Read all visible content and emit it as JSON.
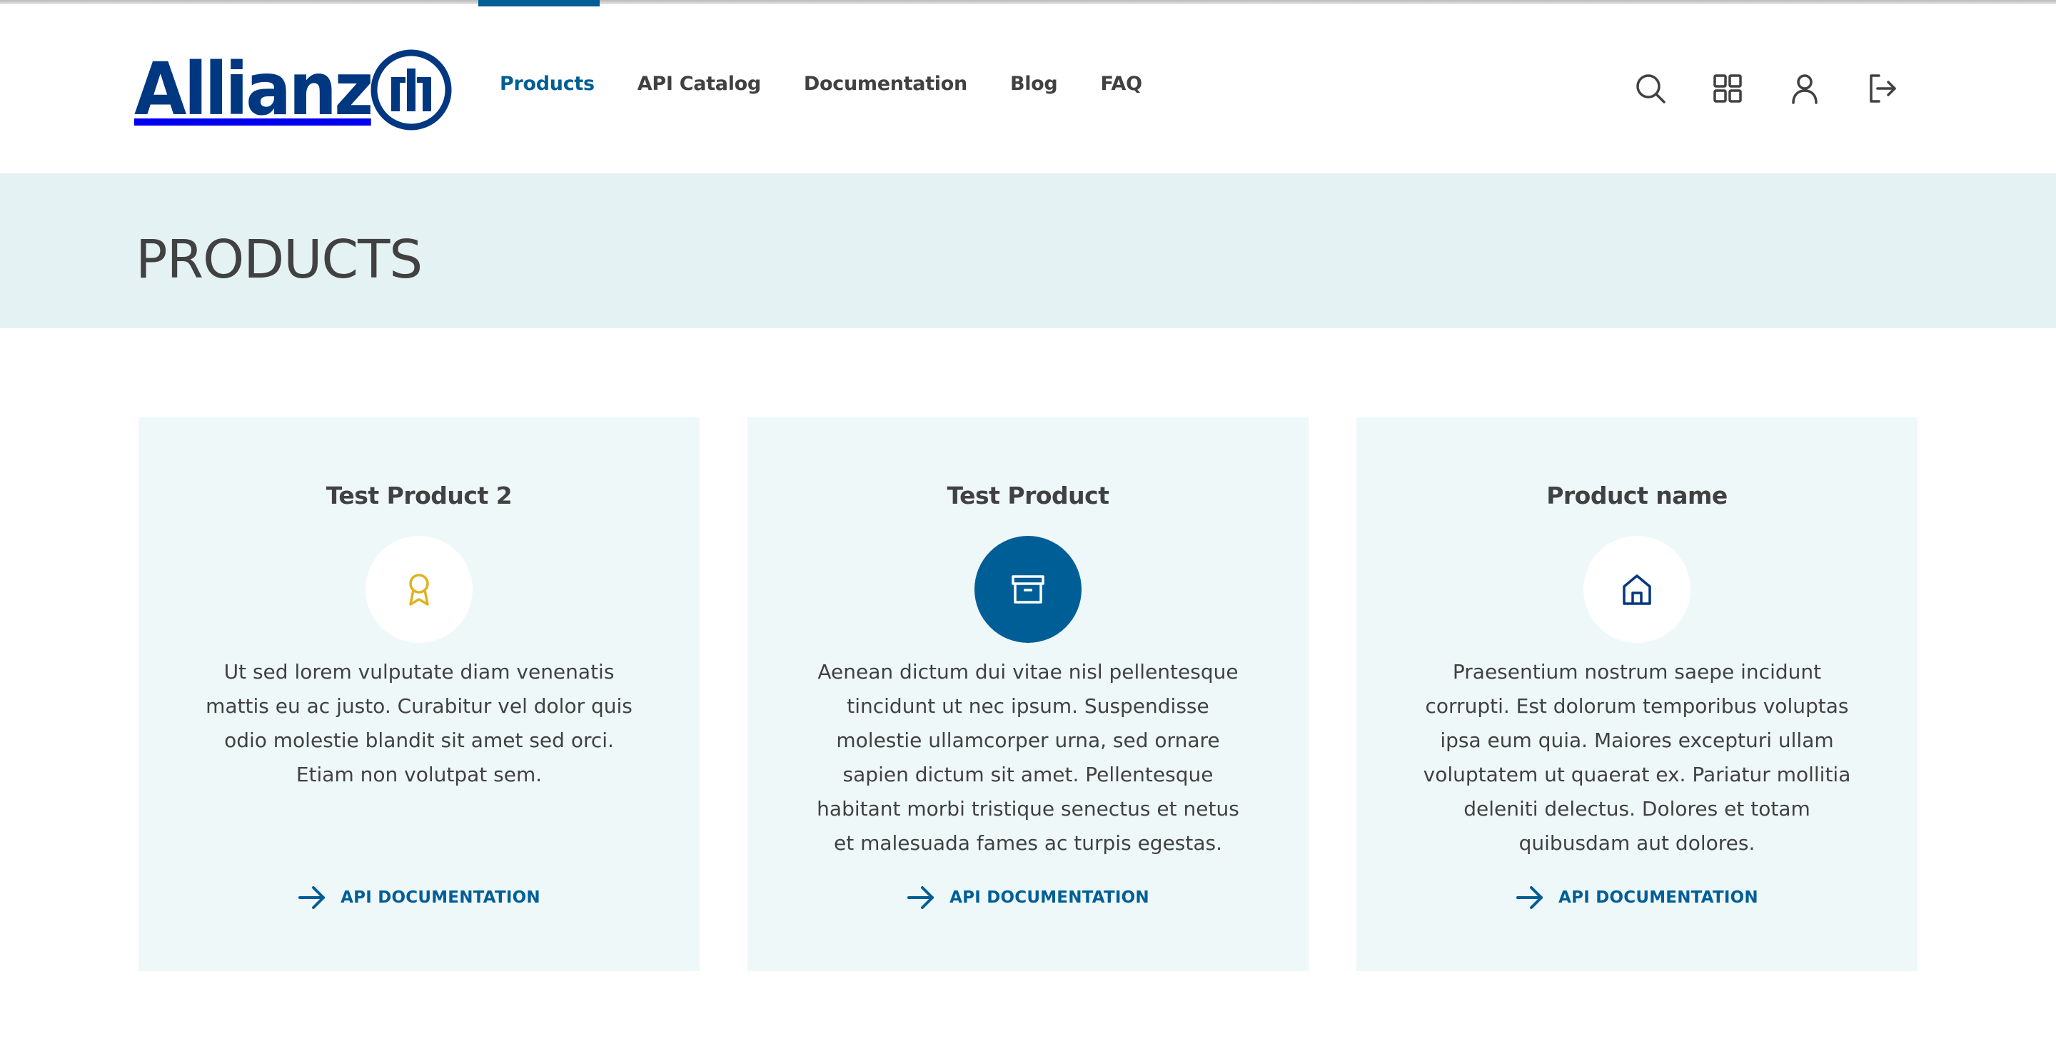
{
  "brand": {
    "name": "Allianz",
    "color": "#003781",
    "accent": "#005e97"
  },
  "nav": {
    "items": [
      {
        "label": "Products",
        "active": true
      },
      {
        "label": "API Catalog",
        "active": false
      },
      {
        "label": "Documentation",
        "active": false
      },
      {
        "label": "Blog",
        "active": false
      },
      {
        "label": "FAQ",
        "active": false
      }
    ]
  },
  "header_icons": [
    "search-icon",
    "apps-grid-icon",
    "user-icon",
    "logout-icon"
  ],
  "banner": {
    "title": "PRODUCTS",
    "background": "#e4f2f3"
  },
  "products": [
    {
      "title": "Test Product 2",
      "icon": "award-ribbon-icon",
      "icon_color": "#e0b21f",
      "icon_bg": "#ffffff",
      "description": "Ut sed lorem vulputate diam venenatis mattis eu ac justo. Curabitur vel dolor quis odio molestie blandit sit amet sed orci. Etiam non volutpat sem.",
      "link_label": "API DOCUMENTATION"
    },
    {
      "title": "Test Product",
      "icon": "archive-box-icon",
      "icon_color": "#ffffff",
      "icon_bg": "#005e97",
      "description": "Aenean dictum dui vitae nisl pellentesque tincidunt ut nec ipsum. Suspendisse molestie ullamcorper urna, sed ornare sapien dictum sit amet. Pellentesque habitant morbi tristique senectus et netus et malesuada fames ac turpis egestas.",
      "link_label": "API DOCUMENTATION"
    },
    {
      "title": "Product name",
      "icon": "home-icon",
      "icon_color": "#003781",
      "icon_bg": "#ffffff",
      "description": "Praesentium nostrum saepe incidunt corrupti. Est dolorum temporibus voluptas ipsa eum quia. Maiores excepturi ullam voluptatem ut quaerat ex. Pariatur mollitia deleniti delectus. Dolores et totam quibusdam aut dolores.",
      "link_label": "API DOCUMENTATION"
    }
  ]
}
